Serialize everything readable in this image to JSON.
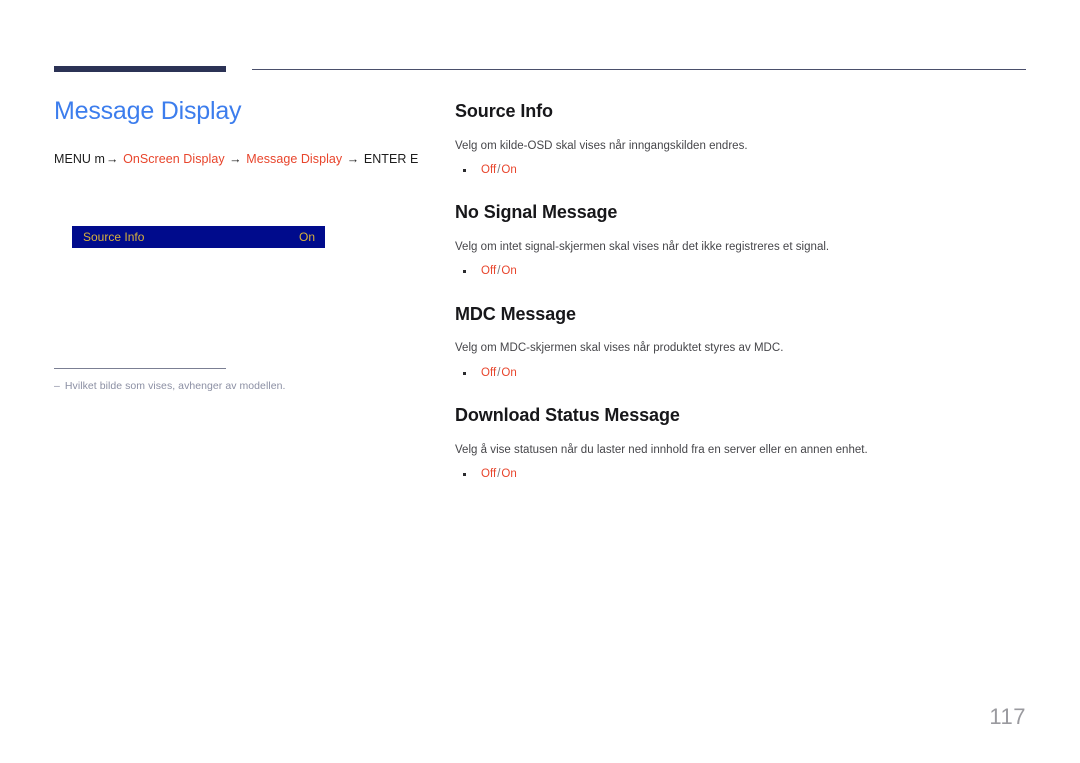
{
  "document": {
    "page_number": "117",
    "title": "Message Display",
    "title_color": "#3c7ded",
    "accent_color": "#e8452c",
    "rule_color": "#2b3255"
  },
  "breadcrumb": {
    "prefix": "MENU m",
    "arrow": "→",
    "item1": "OnScreen Display",
    "item2": "Message Display",
    "suffix": "ENTER E"
  },
  "osd_preview": {
    "label": "Source Info",
    "value": "On",
    "background": "#000b8c",
    "text_color": "#d8b13a"
  },
  "footnote": {
    "dash": "–",
    "text": "Hvilket bilde som vises, avhenger av modellen."
  },
  "sections": [
    {
      "title": "Source Info",
      "description": "Velg om kilde-OSD skal vises når inngangskilden endres.",
      "option_off": "Off",
      "separator": "/",
      "option_on": "On"
    },
    {
      "title": "No Signal Message",
      "description": "Velg om intet signal-skjermen skal vises når det ikke registreres et signal.",
      "option_off": "Off",
      "separator": "/",
      "option_on": "On"
    },
    {
      "title": "MDC Message",
      "description": "Velg om MDC-skjermen skal vises når produktet styres av MDC.",
      "option_off": "Off",
      "separator": "/",
      "option_on": "On"
    },
    {
      "title": "Download Status Message",
      "description": "Velg å vise statusen når du laster ned innhold fra en server eller en annen enhet.",
      "option_off": "Off",
      "separator": "/",
      "option_on": "On"
    }
  ]
}
